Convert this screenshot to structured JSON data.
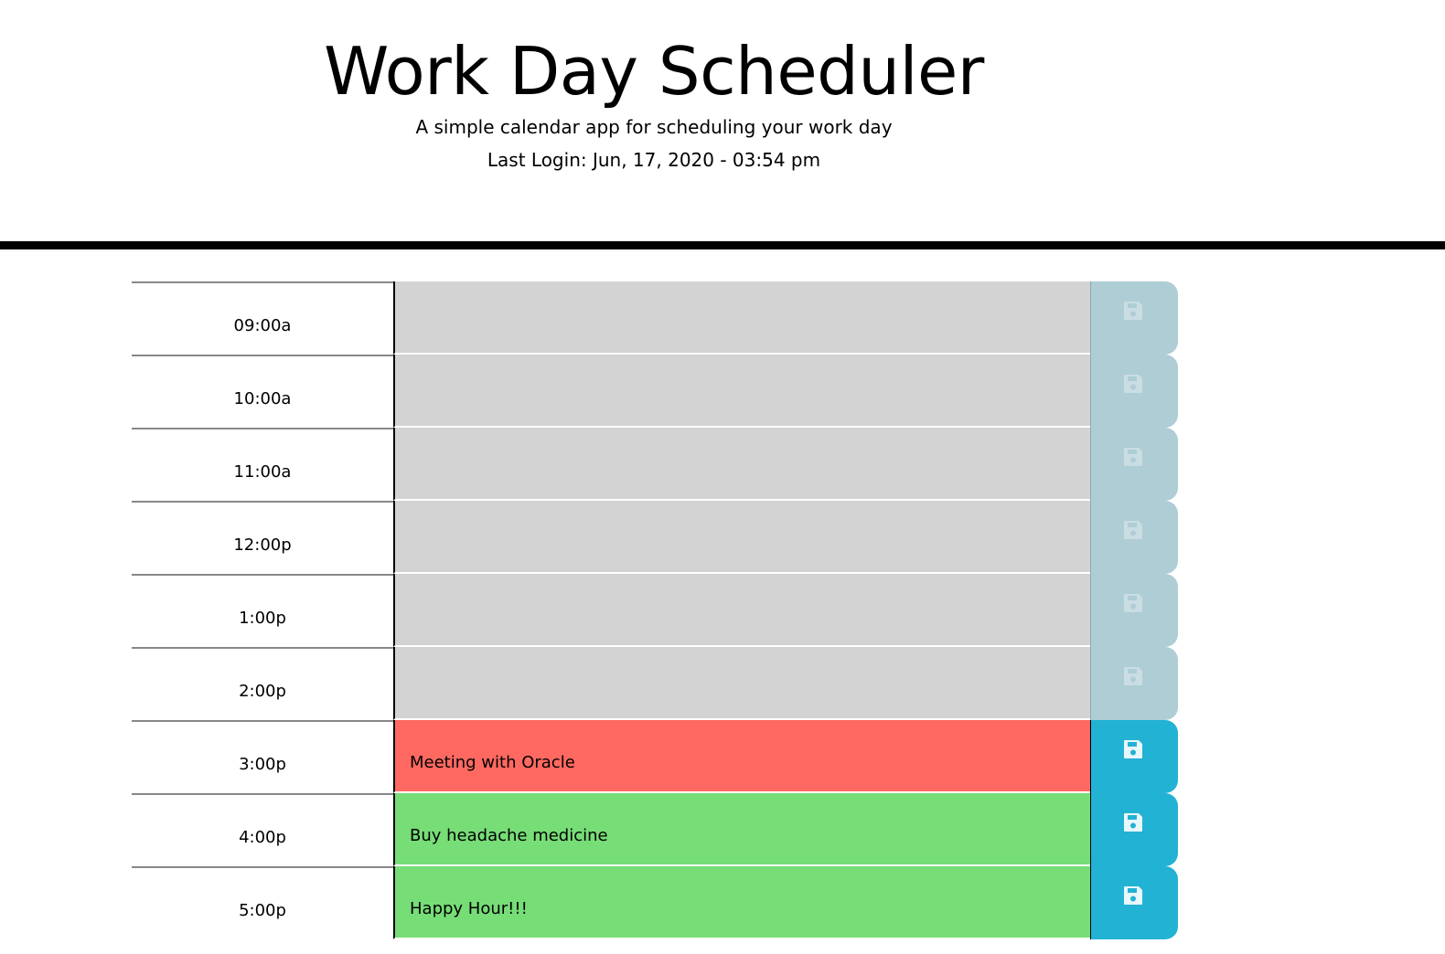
{
  "header": {
    "title": "Work Day Scheduler",
    "subtitle": "A simple calendar app for scheduling your work day",
    "last_login": "Last Login: Jun, 17, 2020 - 03:54 pm"
  },
  "colors": {
    "past": "#d3d3d3",
    "present": "#ff6961",
    "future": "#77dd77",
    "save_button": "#22b2d4"
  },
  "icons": {
    "save": "floppy-disk-icon"
  },
  "timeblocks": [
    {
      "hour": "09:00a",
      "status": "past",
      "text": ""
    },
    {
      "hour": "10:00a",
      "status": "past",
      "text": ""
    },
    {
      "hour": "11:00a",
      "status": "past",
      "text": ""
    },
    {
      "hour": "12:00p",
      "status": "past",
      "text": ""
    },
    {
      "hour": "1:00p",
      "status": "past",
      "text": ""
    },
    {
      "hour": "2:00p",
      "status": "past",
      "text": ""
    },
    {
      "hour": "3:00p",
      "status": "present",
      "text": "Meeting with Oracle"
    },
    {
      "hour": "4:00p",
      "status": "future",
      "text": "Buy headache medicine"
    },
    {
      "hour": "5:00p",
      "status": "future",
      "text": "Happy Hour!!!"
    }
  ]
}
